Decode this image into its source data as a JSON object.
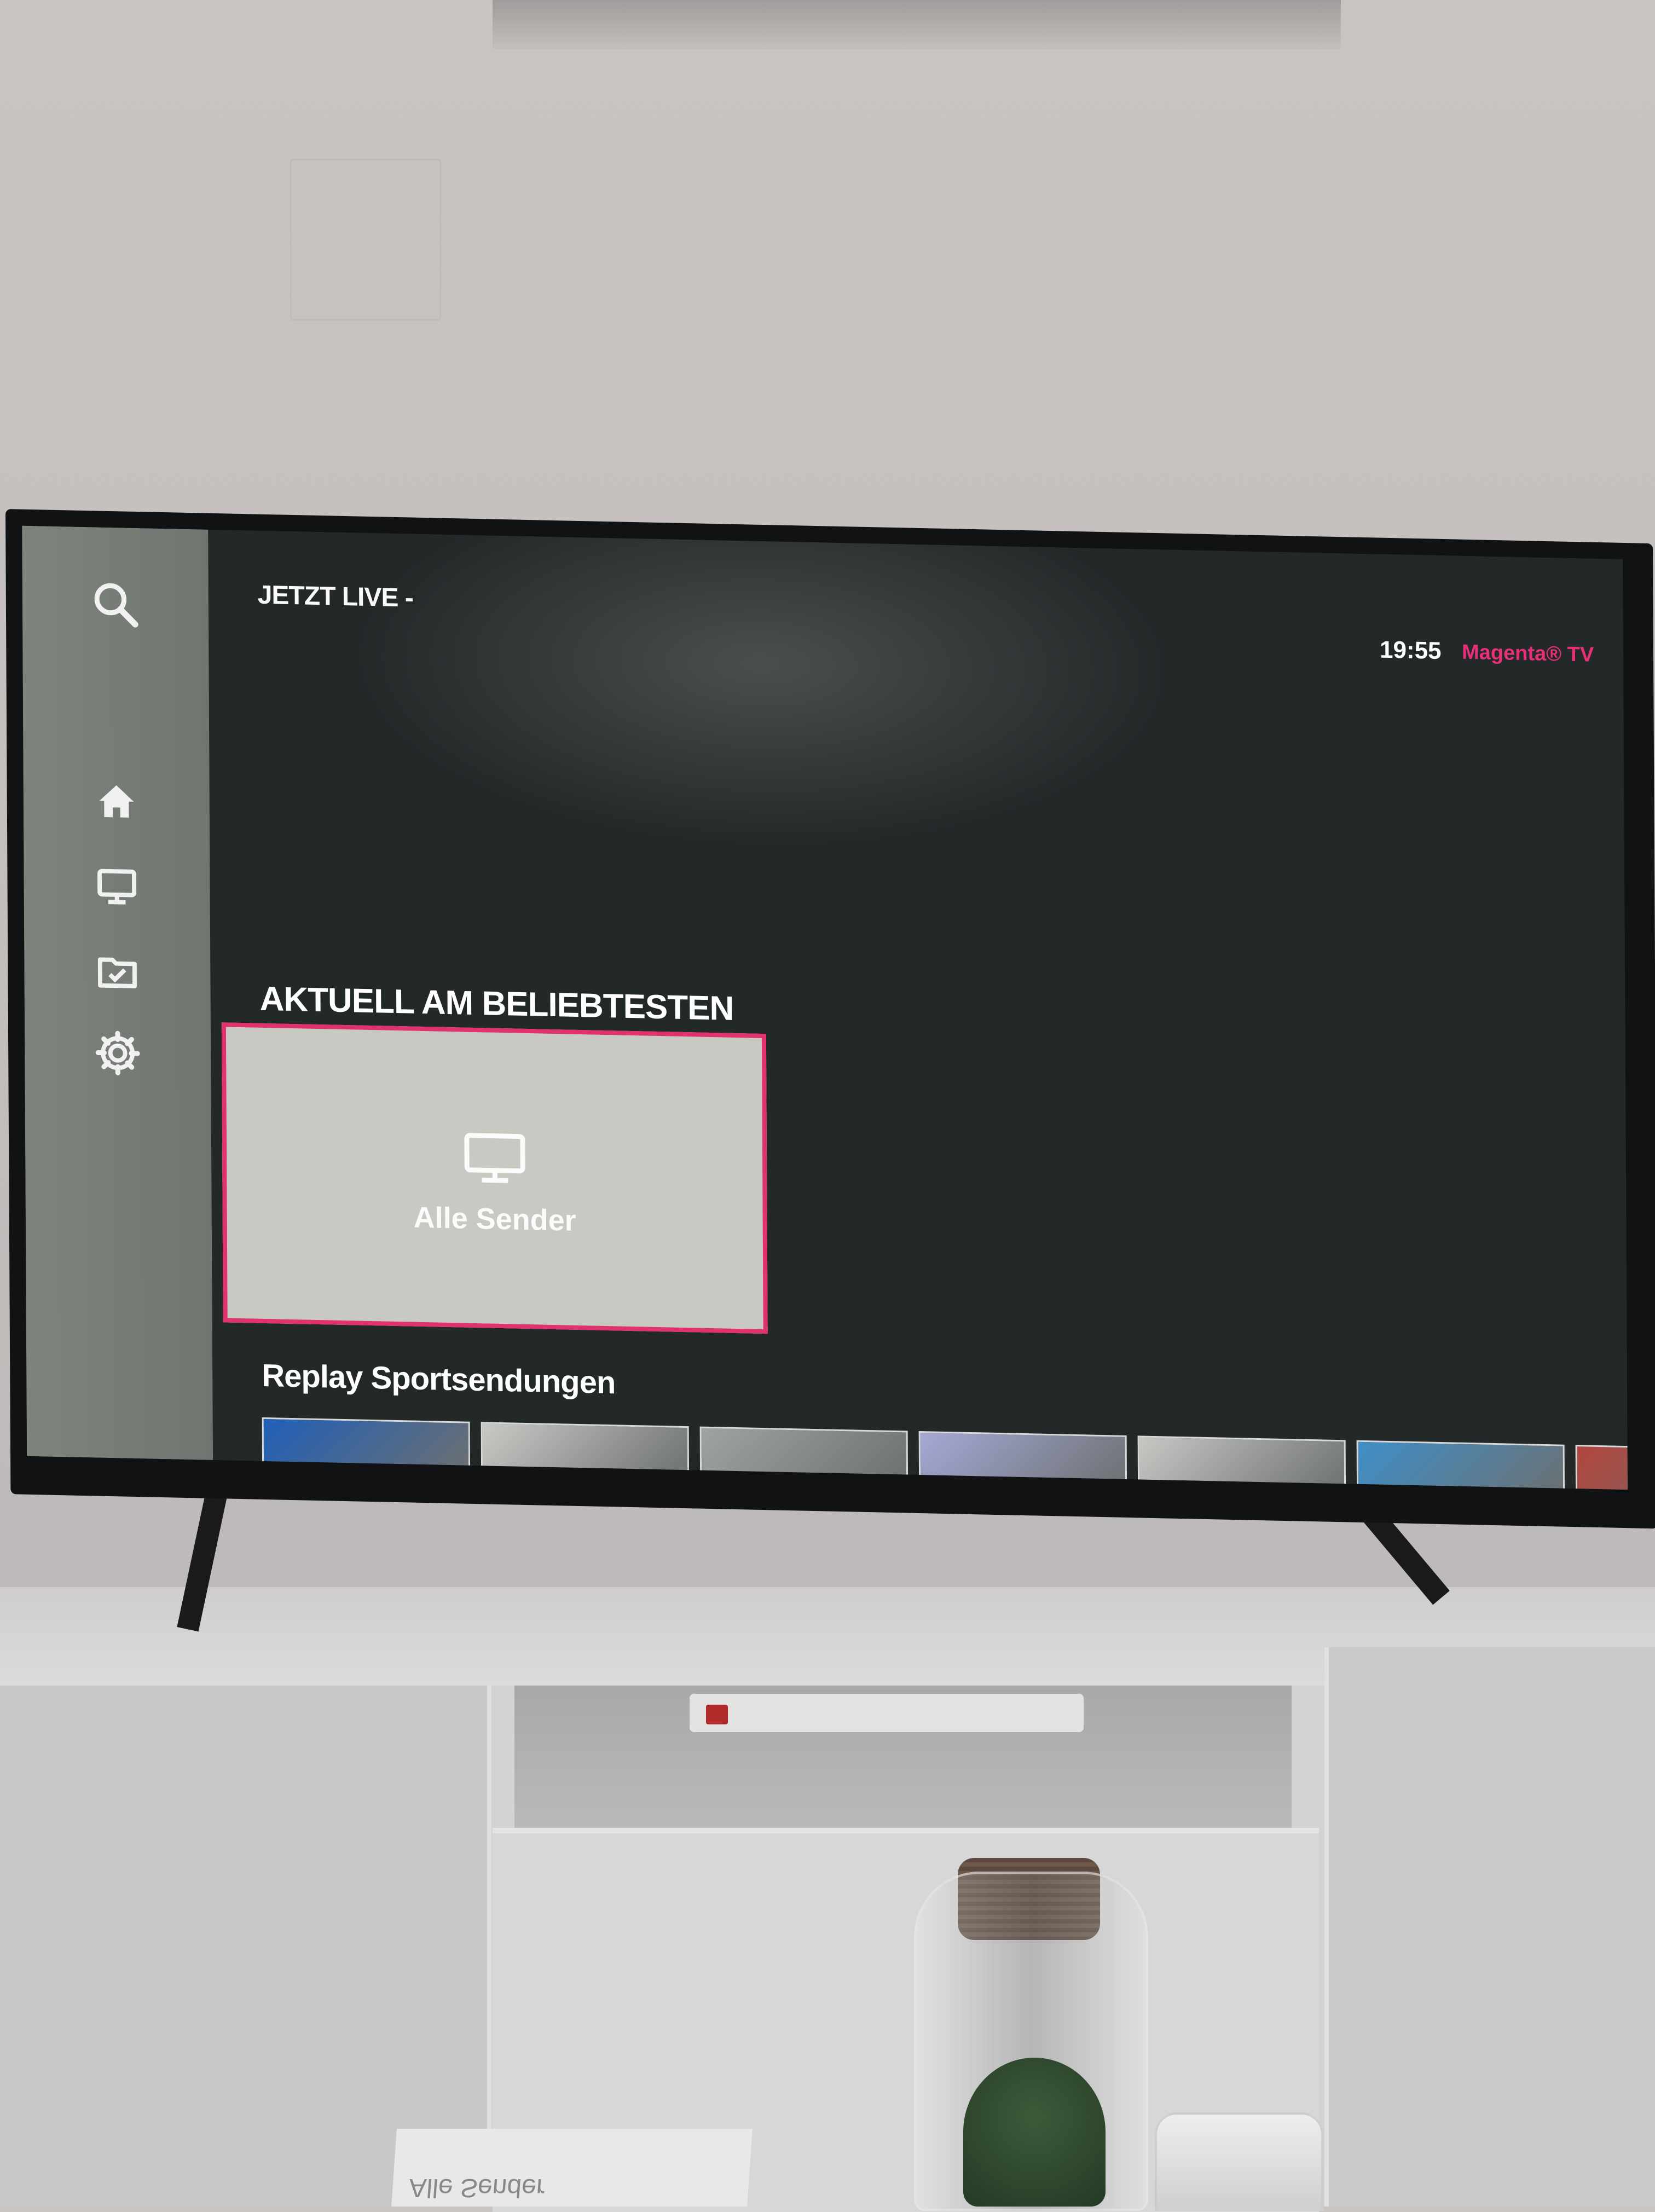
{
  "sidebar": {
    "items": [
      {
        "icon": "search-icon"
      },
      {
        "icon": "home-icon"
      },
      {
        "icon": "tv-icon"
      },
      {
        "icon": "recordings-icon"
      },
      {
        "icon": "gear-icon"
      }
    ]
  },
  "header": {
    "live_label": "JETZT LIVE -",
    "time": "19:55",
    "brand": "Magenta® TV"
  },
  "popular": {
    "title": "AKTUELL AM BELIEBTESTEN",
    "tile_label": "Alle Sender",
    "tile_icon": "tv-icon"
  },
  "replay": {
    "title": "Replay Sportsendungen",
    "thumbnail_colors": [
      "#1f5fb8",
      "#c9cac6",
      "#9fa4a3",
      "#a4a9d6",
      "#c6c8c4",
      "#3f8fc8",
      "#b2463e"
    ]
  },
  "colors": {
    "accent": "#e2326e",
    "sidebar": "#767d76",
    "screen_bg": "#232829"
  },
  "reflection_text": "Alle Sender"
}
